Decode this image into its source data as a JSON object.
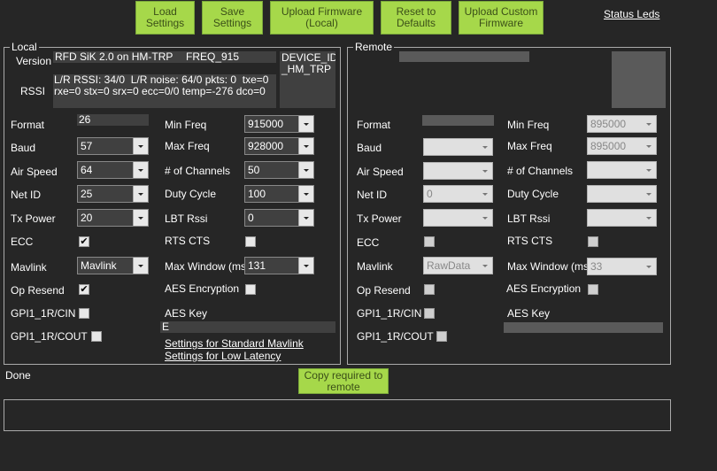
{
  "toolbar": {
    "load": "Load\nSettings",
    "save": "Save\nSettings",
    "upload_fw": "Upload Firmware\n(Local)",
    "reset": "Reset to\nDefaults",
    "upload_custom": "Upload Custom\nFirmware",
    "status_leds": "Status Leds"
  },
  "local": {
    "title": "Local",
    "version_label": "Version",
    "version_value": "RFD SiK 2.0 on HM-TRP",
    "freq_value": "FREQ_915",
    "device_id": "DEVICE_ID\n_HM_TRP",
    "rssi_label": "RSSI",
    "rssi_value": "L/R RSSI: 34/0  L/R noise: 64/0 pkts: 0  txe=0\nrxe=0 stx=0 srx=0 ecc=0/0 temp=-276 dco=0",
    "labels": {
      "format": "Format",
      "baud": "Baud",
      "air_speed": "Air Speed",
      "net_id": "Net ID",
      "tx_power": "Tx Power",
      "ecc": "ECC",
      "mavlink": "Mavlink",
      "op_resend": "Op Resend",
      "gpi_cin": "GPI1_1R/CIN",
      "gpi_cout": "GPI1_1R/COUT",
      "min_freq": "Min Freq",
      "max_freq": "Max Freq",
      "channels": "# of Channels",
      "duty": "Duty Cycle",
      "lbt": "LBT Rssi",
      "rts": "RTS CTS",
      "max_window": "Max Window (ms)",
      "aes_enc": "AES Encryption",
      "aes_key": "AES Key"
    },
    "values": {
      "format": "26",
      "baud": "57",
      "air_speed": "64",
      "net_id": "25",
      "tx_power": "20",
      "mavlink": "Mavlink",
      "min_freq": "915000",
      "max_freq": "928000",
      "channels": "50",
      "duty": "100",
      "lbt": "0",
      "max_window": "131",
      "aes_key": "E"
    },
    "checks": {
      "ecc": "✔",
      "op_resend": "✔",
      "gpi_cin": "",
      "gpi_cout": "",
      "rts": "",
      "aes": ""
    },
    "link_mavlink": "Settings for Standard Mavlink",
    "link_latency": "Settings for Low Latency"
  },
  "remote": {
    "title": "Remote",
    "labels": {
      "format": "Format",
      "baud": "Baud",
      "air_speed": "Air Speed",
      "net_id": "Net ID",
      "tx_power": "Tx Power",
      "ecc": "ECC",
      "mavlink": "Mavlink",
      "op_resend": "Op Resend",
      "gpi_cin": "GPI1_1R/CIN",
      "gpi_cout": "GPI1_1R/COUT",
      "min_freq": "Min Freq",
      "max_freq": "Max Freq",
      "channels": "# of Channels",
      "duty": "Duty Cycle",
      "lbt": "LBT Rssi",
      "rts": "RTS CTS",
      "max_window": "Max Window (ms)",
      "aes_enc": "AES Encryption",
      "aes_key": "AES Key"
    },
    "values": {
      "net_id": "0",
      "mavlink": "RawData",
      "min_freq": "895000",
      "max_freq": "895000",
      "max_window": "33"
    }
  },
  "status": {
    "done": "Done",
    "copy": "Copy required to\nremote"
  }
}
